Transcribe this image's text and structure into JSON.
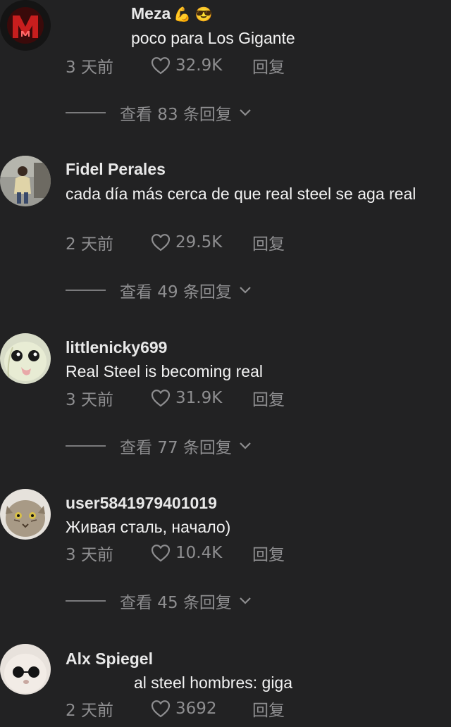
{
  "comments": [
    {
      "username": "Meza",
      "username_emojis": "💪 😎",
      "text": "poco para Los Gigante",
      "time": "3 天前",
      "likes": "32.9K",
      "reply_label": "回复",
      "view_replies": "查看 83 条回复"
    },
    {
      "username": "Fidel Perales",
      "text": "cada día más cerca de que real steel se aga real",
      "time": "2 天前",
      "likes": "29.5K",
      "reply_label": "回复",
      "view_replies": "查看 49 条回复"
    },
    {
      "username": "littlenicky699",
      "text": "Real Steel is becoming real",
      "time": "3 天前",
      "likes": "31.9K",
      "reply_label": "回复",
      "view_replies": "查看 77 条回复"
    },
    {
      "username": "user5841979401019",
      "text": "Живая сталь, начало)",
      "time": "3 天前",
      "likes": "10.4K",
      "reply_label": "回复",
      "view_replies": "查看 45 条回复"
    },
    {
      "username": "Alx Spiegel",
      "text": "al steel hombres: giga",
      "time": "2 天前",
      "likes": "3692",
      "reply_label": "回复"
    }
  ],
  "icons": {
    "like": "heart-outline-icon",
    "expand": "chevron-down-icon"
  },
  "colors": {
    "background": "#222223",
    "username": "#e8e8e8",
    "text": "#f2f2f2",
    "secondary": "#8e8e90"
  }
}
